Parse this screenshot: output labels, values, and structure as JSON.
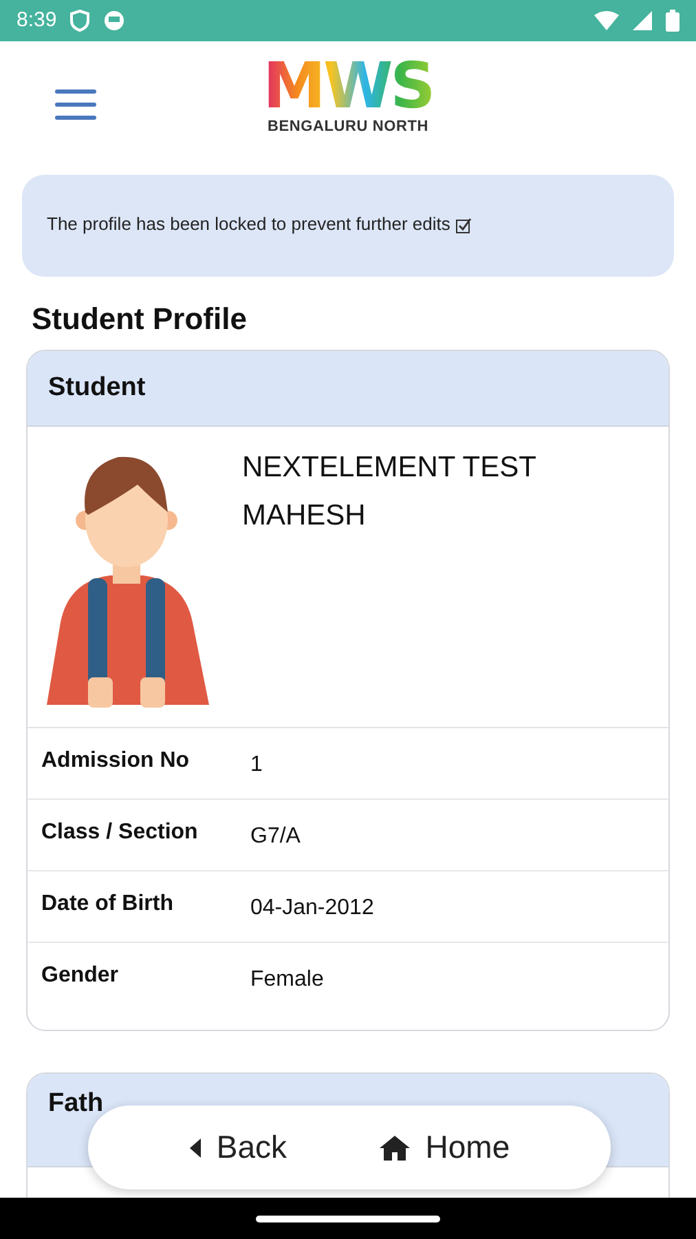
{
  "status_bar": {
    "time": "8:39"
  },
  "header": {
    "logo": "MWS",
    "logo_subtitle": "BENGALURU NORTH"
  },
  "notice": {
    "text": "The profile has been locked to prevent further edits",
    "checked": true
  },
  "page_title": "Student Profile",
  "student_card": {
    "title": "Student",
    "name": "NEXTELEMENT TEST MAHESH",
    "fields": [
      {
        "label": "Admission No",
        "value": "1"
      },
      {
        "label": "Class / Section",
        "value": "G7/A"
      },
      {
        "label": "Date of Birth",
        "value": "04-Jan-2012"
      },
      {
        "label": "Gender",
        "value": "Female"
      }
    ]
  },
  "father_card": {
    "title": "Fath"
  },
  "bottom_nav": [
    {
      "kind": "back",
      "label": "Back"
    },
    {
      "kind": "home",
      "label": "Home"
    }
  ]
}
